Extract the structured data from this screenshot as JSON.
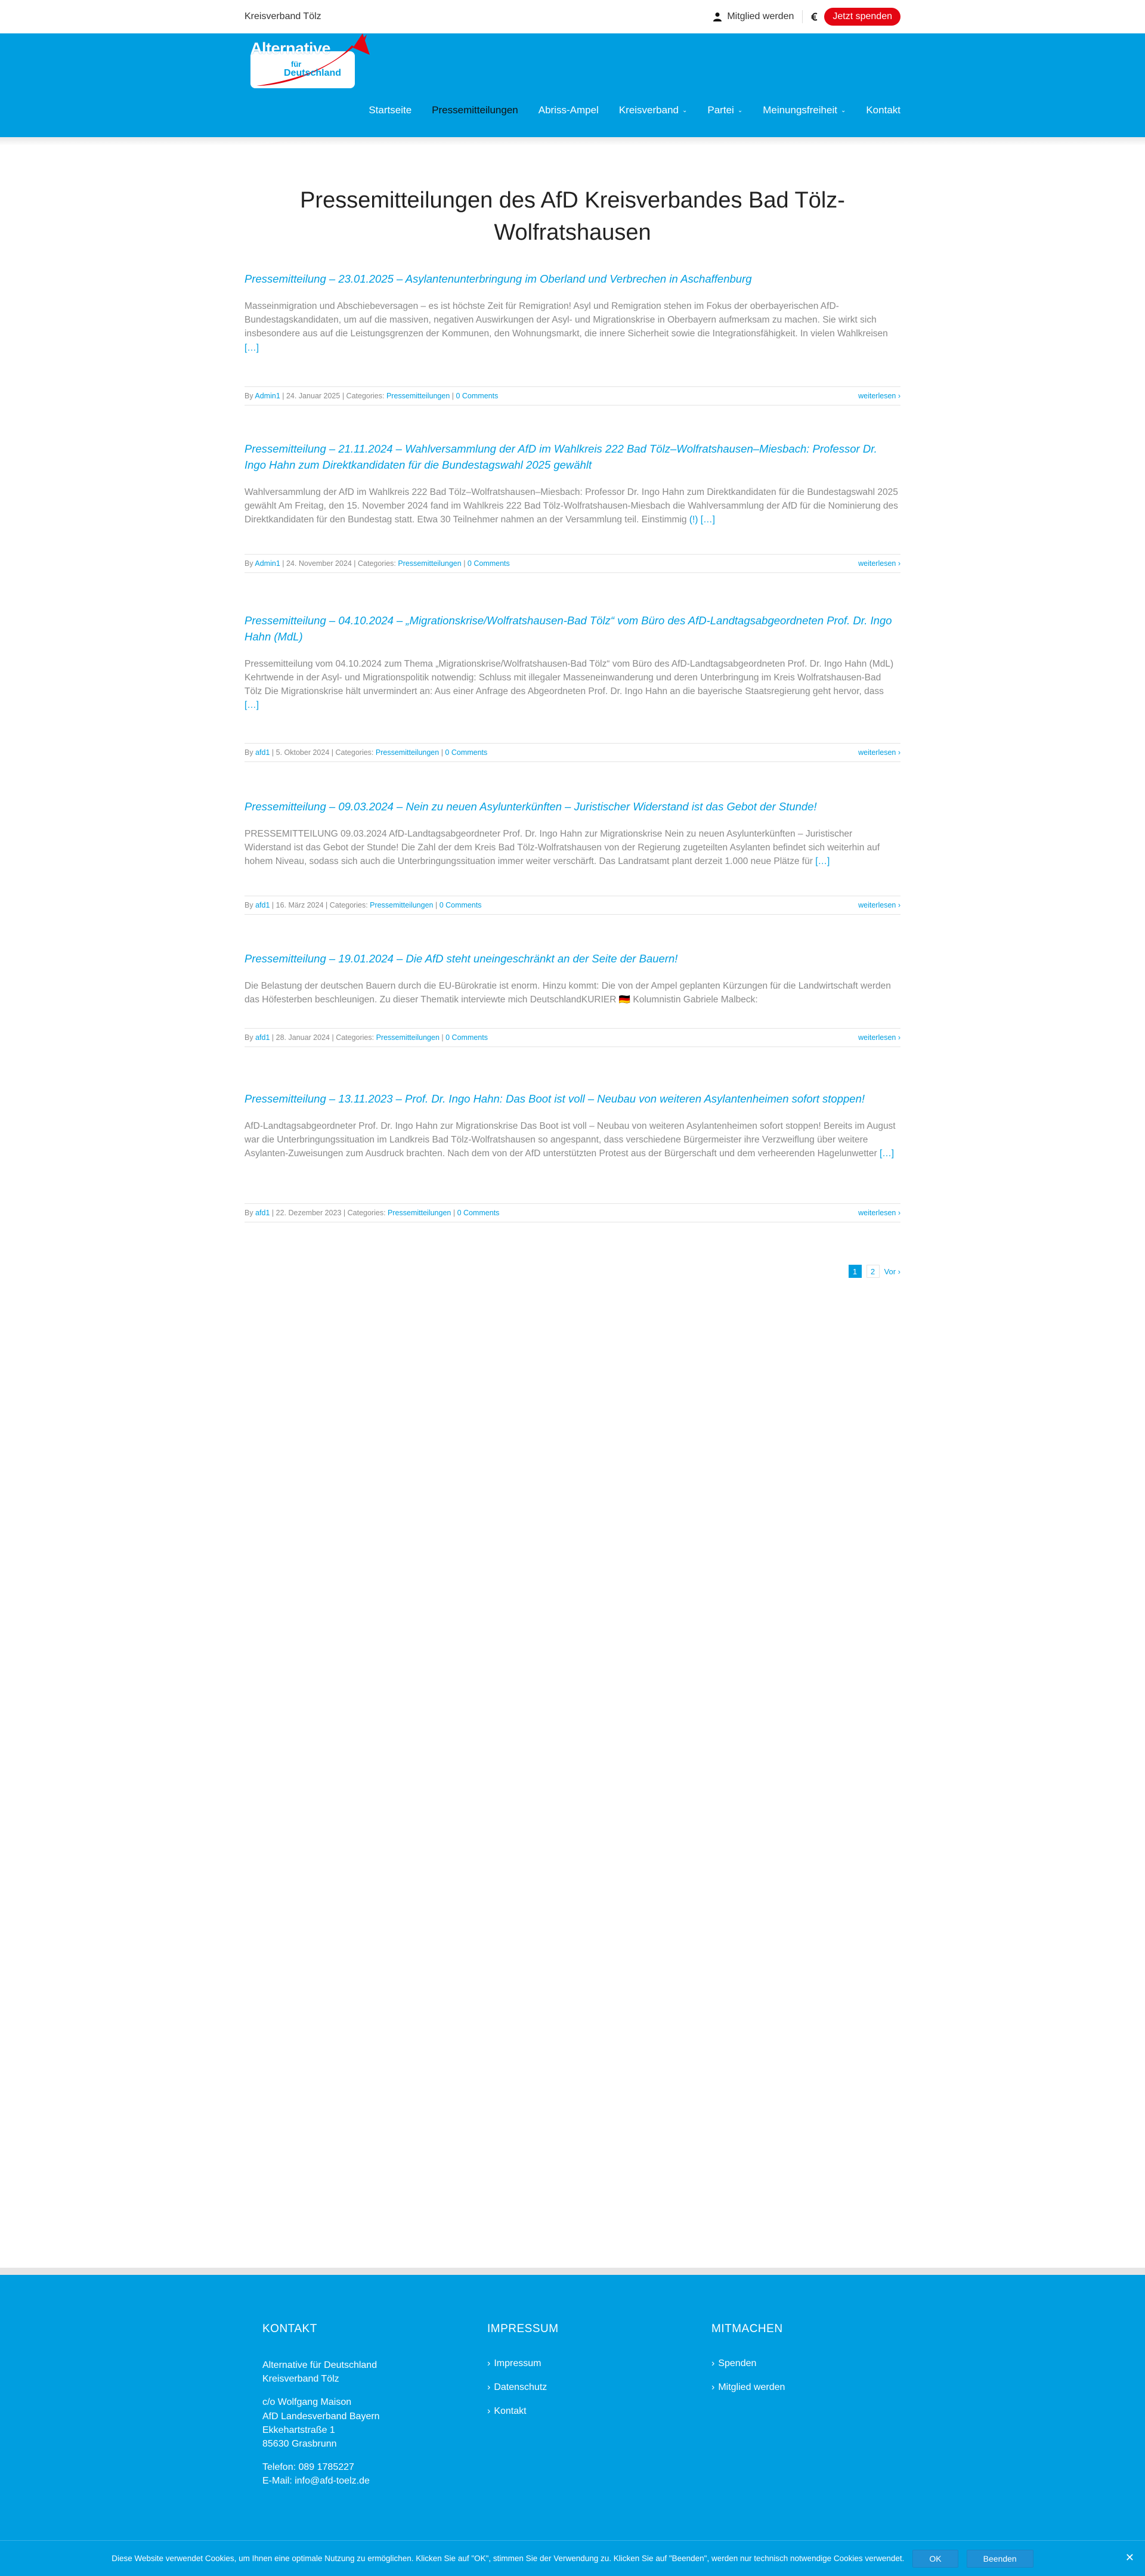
{
  "topbar": {
    "site_name": "Kreisverband Tölz",
    "member_label": "Mitglied werden",
    "donate_label": "Jetzt spenden"
  },
  "logo": {
    "line1": "Alternative",
    "line2": "für",
    "line3": "Deutschland"
  },
  "nav": {
    "items": [
      {
        "label": "Startseite"
      },
      {
        "label": "Pressemitteilungen"
      },
      {
        "label": "Abriss-Ampel"
      },
      {
        "label": "Kreisverband"
      },
      {
        "label": "Partei"
      },
      {
        "label": "Meinungsfreiheit"
      },
      {
        "label": "Kontakt"
      }
    ]
  },
  "page_title": "Pressemitteilungen des AfD Kreisverbandes Bad Tölz-Wolfratshausen",
  "posts": [
    {
      "title": "Pressemitteilung – 23.01.2025 – Asylantenunterbringung im Oberland und Verbrechen in Aschaffenburg",
      "excerpt": "Masseinmigration und Abschiebeversagen – es ist höchste Zeit für Remigration! Asyl und Remigration stehen im Fokus der oberbayerischen AfD-Bundestagskandidaten, um auf die massiven, negativen Auswirkungen der Asyl- und Migrationskrise in Oberbayern aufmerksam zu machen. Sie wirkt sich insbesondere aus auf die Leistungsgrenzen der Kommunen, den Wohnungsmarkt, die innere Sicherheit sowie die Integrationsfähigkeit. In vielen Wahlkreisen",
      "more": "[…]",
      "by": "By",
      "author": "Admin1",
      "date": "24. Januar 2025",
      "cat_label": "Categories:",
      "category": "Pressemitteilungen",
      "comments": "0 Comments",
      "read_more": "weiterlesen"
    },
    {
      "title": "Pressemitteilung – 21.11.2024 – Wahlversammlung der AfD im Wahlkreis 222 Bad Tölz–Wolfratshausen–Miesbach: Professor Dr. Ingo Hahn zum Direktkandidaten für die Bundestagswahl 2025 gewählt",
      "excerpt": "Wahlversammlung der AfD im Wahlkreis 222 Bad Tölz–Wolfratshausen–Miesbach: Professor Dr. Ingo Hahn zum Direktkandidaten für die Bundestagswahl 2025 gewählt   Am Freitag, den 15. November 2024 fand im Wahlkreis 222 Bad Tölz-Wolfratshausen-Miesbach die Wahlversammlung der AfD für die Nominierung des Direktkandidaten für den Bundestag statt. Etwa 30 Teilnehmer nahmen an der Versammlung teil. Einstimmig",
      "more": "(!) […]",
      "by": "By",
      "author": "Admin1",
      "date": "24. November 2024",
      "cat_label": "Categories:",
      "category": "Pressemitteilungen",
      "comments": "0 Comments",
      "read_more": "weiterlesen"
    },
    {
      "title": "Pressemitteilung – 04.10.2024 – „Migrationskrise/Wolfratshausen-Bad Tölz“ vom Büro des AfD-Landtagsabgeordneten Prof. Dr. Ingo Hahn (MdL)",
      "excerpt": "Pressemitteilung vom 04.10.2024 zum Thema „Migrationskrise/Wolfratshausen-Bad Tölz“ vom Büro des AfD-Landtagsabgeordneten Prof. Dr. Ingo Hahn (MdL) Kehrtwende in der Asyl- und Migrationspolitik notwendig: Schluss mit illegaler Masseneinwanderung und deren Unterbringung im Kreis Wolfratshausen-Bad Tölz Die Migrationskrise hält unvermindert an: Aus einer Anfrage des Abgeordneten Prof. Dr. Ingo Hahn an die bayerische Staatsregierung geht hervor, dass",
      "more": "[…]",
      "by": "By",
      "author": "afd1",
      "date": "5. Oktober 2024",
      "cat_label": "Categories:",
      "category": "Pressemitteilungen",
      "comments": "0 Comments",
      "read_more": "weiterlesen"
    },
    {
      "title": "Pressemitteilung – 09.03.2024 – Nein zu neuen Asylunterkünften – Juristischer Widerstand ist das Gebot der Stunde!",
      "excerpt": "PRESSEMITTEILUNG 09.03.2024 AfD-Landtagsabgeordneter Prof. Dr. Ingo Hahn zur Migrationskrise Nein zu neuen Asylunterkünften – Juristischer Widerstand ist das Gebot der Stunde! Die Zahl der dem Kreis Bad Tölz-Wolfratshausen von der Regierung zugeteilten Asylanten befindet sich weiterhin auf hohem Niveau, sodass sich auch die Unterbringungssituation immer weiter verschärft. Das Landratsamt plant derzeit 1.000 neue Plätze für",
      "more": "[…]",
      "by": "By",
      "author": "afd1",
      "date": "16. März 2024",
      "cat_label": "Categories:",
      "category": "Pressemitteilungen",
      "comments": "0 Comments",
      "read_more": "weiterlesen"
    },
    {
      "title": "Pressemitteilung – 19.01.2024 – Die AfD steht uneingeschränkt an der Seite der Bauern!",
      "excerpt": "Die Belastung der deutschen Bauern durch die EU-Bürokratie ist enorm. Hinzu kommt: Die von der Ampel geplanten Kürzungen für die Landwirtschaft werden das Höfesterben beschleunigen. Zu dieser Thematik interviewte mich DeutschlandKURIER 🇩🇪 Kolumnistin Gabriele Malbeck:",
      "more": "",
      "by": "By",
      "author": "afd1",
      "date": "28. Januar 2024",
      "cat_label": "Categories:",
      "category": "Pressemitteilungen",
      "comments": "0 Comments",
      "read_more": "weiterlesen"
    },
    {
      "title": "Pressemitteilung – 13.11.2023 – Prof. Dr. Ingo Hahn: Das Boot ist voll – Neubau von weiteren Asylantenheimen sofort stoppen!",
      "excerpt": "AfD-Landtagsabgeordneter Prof. Dr. Ingo Hahn zur Migrationskrise Das Boot ist voll – Neubau von weiteren Asylantenheimen sofort stoppen! Bereits im August war die Unterbringungssituation im Landkreis Bad Tölz-Wolfratshausen so angespannt, dass verschiedene Bürgermeister ihre Verzweiflung über weitere Asylanten-Zuweisungen zum Ausdruck brachten. Nach dem von der AfD unterstützten Protest aus der Bürgerschaft und dem verheerenden Hagelunwetter",
      "more": "[…]",
      "by": "By",
      "author": "afd1",
      "date": "22. Dezember 2023",
      "cat_label": "Categories:",
      "category": "Pressemitteilungen",
      "comments": "0 Comments",
      "read_more": "weiterlesen"
    }
  ],
  "pagination": {
    "current": "1",
    "next_page": "2",
    "next_label": "Vor"
  },
  "footer": {
    "col1": {
      "heading": "KONTAKT",
      "org_line1": "Alternative für Deutschland",
      "org_line2": "Kreisverband Tölz",
      "addr_line1": "c/o Wolfgang Maison",
      "addr_line2": "AfD Landesverband Bayern",
      "addr_line3": "Ekkehartstraße 1",
      "addr_line4": "85630 Grasbrunn",
      "phone": "Telefon: 089 1785227",
      "email": "E-Mail: info@afd-toelz.de"
    },
    "col2": {
      "heading": "IMPRESSUM",
      "links": [
        "Impressum",
        "Datenschutz",
        "Kontakt"
      ]
    },
    "col3": {
      "heading": "MITMACHEN",
      "links": [
        "Spenden",
        "Mitglied werden"
      ]
    }
  },
  "cookie": {
    "text": "Diese Website verwendet Cookies, um Ihnen eine optimale Nutzung zu ermöglichen. Klicken Sie auf \"OK\", stimmen Sie der Verwendung zu. Klicken Sie auf \"Beenden\", werden nur technisch notwendige Cookies verwendet.",
    "ok_label": "OK",
    "end_label": "Beenden"
  },
  "colors": {
    "brand_blue": "#009ee0",
    "brand_red": "#e30613"
  }
}
